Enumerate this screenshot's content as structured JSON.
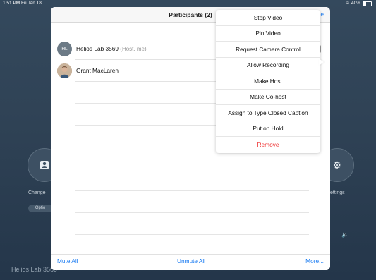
{
  "status_bar": {
    "time_date": "1:51 PM  Fri Jan 18",
    "battery": "40%"
  },
  "background": {
    "left_button_label_fragment": "Change",
    "left_pill_label_fragment": "Optio",
    "right_button_label_fragment": "ettings",
    "meeting_title_fragment": "Helios Lab 3569"
  },
  "panel": {
    "title": "Participants (2)",
    "header_right_fragment": "e"
  },
  "participants": [
    {
      "initials": "HL",
      "name": "Helios Lab 3569",
      "role": "(Host, me)"
    },
    {
      "name": "Grant MacLaren"
    }
  ],
  "footer": {
    "mute_all": "Mute All",
    "unmute_all": "Unmute All",
    "more": "More..."
  },
  "context_menu": {
    "items": [
      "Stop Video",
      "Pin Video",
      "Request Camera Control",
      "Allow Recording",
      "Make Host",
      "Make Co-host",
      "Assign to Type Closed Caption",
      "Put on Hold",
      "Remove"
    ]
  },
  "colors": {
    "accent_blue": "#1b7cf2",
    "danger_red": "#ee2c2c",
    "bg_navy": "#2f4255"
  }
}
